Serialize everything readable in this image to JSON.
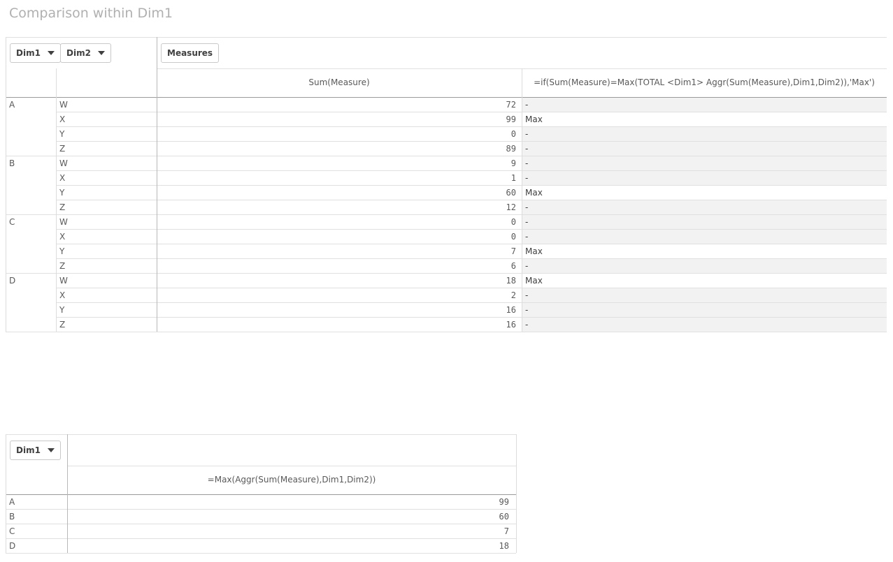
{
  "title": "Comparison within Dim1",
  "pivot1": {
    "dim_buttons": [
      "Dim1",
      "Dim2"
    ],
    "measures_button": "Measures",
    "col_headers": [
      "Sum(Measure)",
      "=if(Sum(Measure)=Max(TOTAL <Dim1> Aggr(Sum(Measure),Dim1,Dim2)),'Max')"
    ],
    "rows": [
      {
        "dim1": "A",
        "dim2": "W",
        "sum": "72",
        "flag": "-"
      },
      {
        "dim1": "",
        "dim2": "X",
        "sum": "99",
        "flag": "Max"
      },
      {
        "dim1": "",
        "dim2": "Y",
        "sum": "0",
        "flag": "-"
      },
      {
        "dim1": "",
        "dim2": "Z",
        "sum": "89",
        "flag": "-"
      },
      {
        "dim1": "B",
        "dim2": "W",
        "sum": "9",
        "flag": "-"
      },
      {
        "dim1": "",
        "dim2": "X",
        "sum": "1",
        "flag": "-"
      },
      {
        "dim1": "",
        "dim2": "Y",
        "sum": "60",
        "flag": "Max"
      },
      {
        "dim1": "",
        "dim2": "Z",
        "sum": "12",
        "flag": "-"
      },
      {
        "dim1": "C",
        "dim2": "W",
        "sum": "0",
        "flag": "-"
      },
      {
        "dim1": "",
        "dim2": "X",
        "sum": "0",
        "flag": "-"
      },
      {
        "dim1": "",
        "dim2": "Y",
        "sum": "7",
        "flag": "Max"
      },
      {
        "dim1": "",
        "dim2": "Z",
        "sum": "6",
        "flag": "-"
      },
      {
        "dim1": "D",
        "dim2": "W",
        "sum": "18",
        "flag": "Max"
      },
      {
        "dim1": "",
        "dim2": "X",
        "sum": "2",
        "flag": "-"
      },
      {
        "dim1": "",
        "dim2": "Y",
        "sum": "16",
        "flag": "-"
      },
      {
        "dim1": "",
        "dim2": "Z",
        "sum": "16",
        "flag": "-"
      }
    ]
  },
  "pivot2": {
    "dim_buttons": [
      "Dim1"
    ],
    "col_header": "=Max(Aggr(Sum(Measure),Dim1,Dim2))",
    "rows": [
      {
        "dim1": "A",
        "value": "99"
      },
      {
        "dim1": "B",
        "value": "60"
      },
      {
        "dim1": "C",
        "value": "7"
      },
      {
        "dim1": "D",
        "value": "18"
      }
    ]
  }
}
